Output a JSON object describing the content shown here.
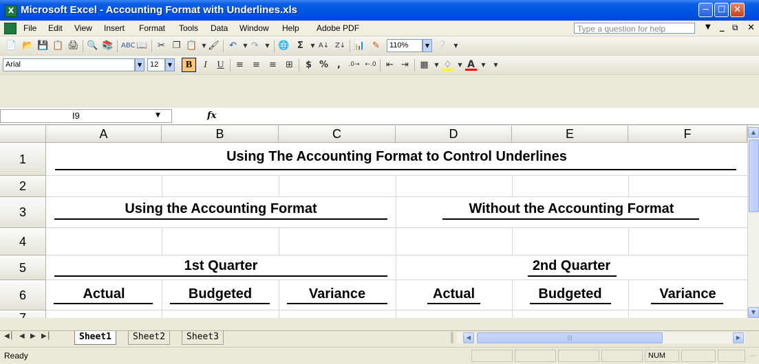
{
  "window": {
    "title": "Microsoft Excel - Accounting Format with Underlines.xls",
    "icon": "excel-icon",
    "controls": [
      "minimize",
      "maximize",
      "close"
    ]
  },
  "menu": {
    "items": [
      "File",
      "Edit",
      "View",
      "Insert",
      "Format",
      "Tools",
      "Data",
      "Window",
      "Help",
      "Adobe PDF"
    ],
    "help_placeholder": "Type a question for help"
  },
  "standard_toolbar": {
    "zoom": "110%"
  },
  "formatting_toolbar": {
    "font": "Arial",
    "size": "12",
    "bold_label": "B",
    "italic_label": "I",
    "underline_label": "U",
    "currency_label": "$",
    "percent_label": "%",
    "comma_label": ",",
    "font_color_label": "A"
  },
  "formula_bar": {
    "name_box": "I9",
    "fx_label": "fx",
    "formula": ""
  },
  "grid": {
    "columns": [
      "A",
      "B",
      "C",
      "D",
      "E",
      "F"
    ],
    "rows": [
      "1",
      "2",
      "3",
      "4",
      "5",
      "6",
      "7"
    ],
    "cells": {
      "title": "Using The Accounting Format to Control Underlines",
      "left_header": "Using the Accounting Format",
      "right_header": "Without the Accounting Format",
      "left_period": "1st Quarter",
      "right_period": "2nd Quarter",
      "a6": "Actual",
      "b6": "Budgeted",
      "c6": "Variance",
      "d6": "Actual",
      "e6": "Budgeted",
      "f6": "Variance"
    }
  },
  "sheets": {
    "tabs": [
      "Sheet1",
      "Sheet2",
      "Sheet3"
    ],
    "active": "Sheet1"
  },
  "status": {
    "text": "Ready",
    "num": "NUM"
  }
}
